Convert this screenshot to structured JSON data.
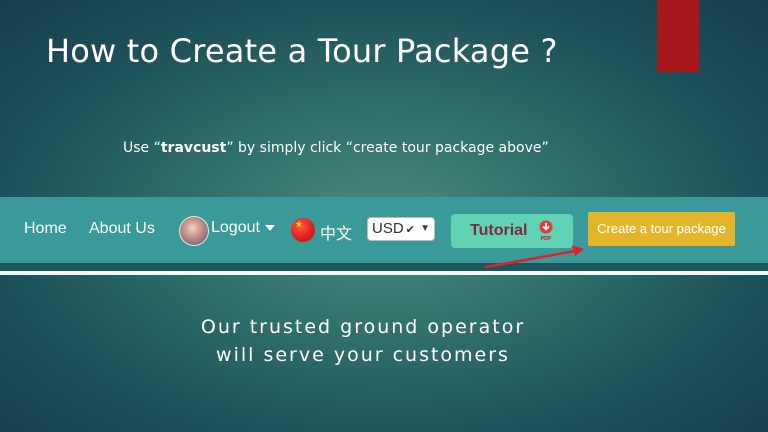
{
  "slide": {
    "title": "How to Create a Tour Package ?",
    "subtitle_prefix": "Use “",
    "subtitle_brand": "travcust",
    "subtitle_suffix": "” by simply click “create tour package above”",
    "tagline_line1": "Our trusted ground operator",
    "tagline_line2": "will serve your customers"
  },
  "navbar": {
    "home": "Home",
    "about": "About Us",
    "logout": "Logout",
    "language": "中文",
    "currency": "USD",
    "tutorial": "Tutorial",
    "pdf_label": "PDF",
    "create": "Create a tour package"
  },
  "colors": {
    "navbar_bg": "#3a9a99",
    "accent_red": "#a8171b",
    "create_button": "#e4b52b",
    "tutorial_button": "#62d2b5"
  },
  "icons": {
    "avatar": "user-avatar",
    "flag": "china-flag-icon",
    "pdf": "pdf-download-icon",
    "arrow": "red-arrow-annotation"
  }
}
